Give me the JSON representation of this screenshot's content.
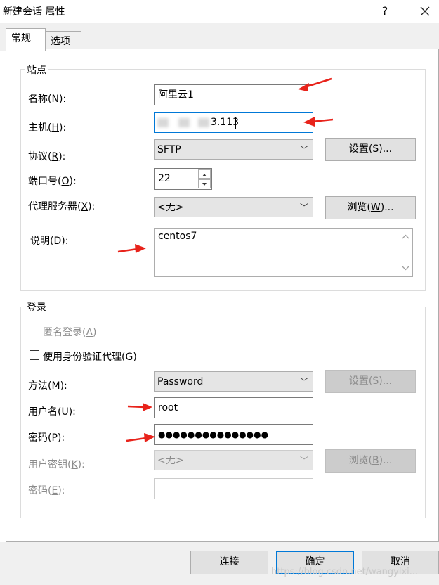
{
  "window": {
    "title": "新建会话 属性",
    "help_label": "?",
    "close_icon": "close-icon"
  },
  "tabs": [
    {
      "label": "常规",
      "active": true
    },
    {
      "label": "选项",
      "active": false
    }
  ],
  "site_group": {
    "title": "站点",
    "name": {
      "label_pre": "名称(",
      "mnemonic": "N",
      "label_post": "):",
      "value": "阿里云1"
    },
    "host": {
      "label_pre": "主机(",
      "mnemonic": "H",
      "label_post": "):",
      "value_visible": "3.113"
    },
    "protocol": {
      "label_pre": "协议(",
      "mnemonic": "R",
      "label_post": "):",
      "value": "SFTP",
      "settings_pre": "设置(",
      "settings_mn": "S",
      "settings_post": ")..."
    },
    "port": {
      "label_pre": "端口号(",
      "mnemonic": "O",
      "label_post": "):",
      "value": "22"
    },
    "proxy": {
      "label_pre": "代理服务器(",
      "mnemonic": "X",
      "label_post": "):",
      "value": "<无>",
      "browse_pre": "浏览(",
      "browse_mn": "W",
      "browse_post": ")..."
    },
    "desc": {
      "label_pre": "说明(",
      "mnemonic": "D",
      "label_post": "):",
      "value": "centos7"
    }
  },
  "login_group": {
    "title": "登录",
    "anonymous": {
      "label_pre": "匿名登录(",
      "mnemonic": "A",
      "label_post": ")",
      "checked": false,
      "enabled": false
    },
    "agent": {
      "label_pre": "使用身份验证代理(",
      "mnemonic": "G",
      "label_post": ")",
      "checked": false,
      "enabled": true
    },
    "method": {
      "label_pre": "方法(",
      "mnemonic": "M",
      "label_post": "):",
      "value": "Password",
      "settings_pre": "设置(",
      "settings_mn": "S",
      "settings_post": ")..."
    },
    "username": {
      "label_pre": "用户名(",
      "mnemonic": "U",
      "label_post": "):",
      "value": "root"
    },
    "password": {
      "label_pre": "密码(",
      "mnemonic": "P",
      "label_post": "):",
      "value": "●●●●●●●●●●●●●●●"
    },
    "user_key": {
      "label_pre": "用户密钥(",
      "mnemonic": "K",
      "label_post": "):",
      "value": "<无>",
      "browse_pre": "浏览(",
      "browse_mn": "B",
      "browse_post": ")..."
    },
    "passphrase": {
      "label_pre": "密码(",
      "mnemonic": "E",
      "label_post": "):",
      "value": ""
    }
  },
  "footer": {
    "connect_label": "连接",
    "ok_label": "确定",
    "cancel_label": "取消",
    "watermark": "https://blog.csdn.net/wangyixi..."
  },
  "colors": {
    "accent": "#0078d7",
    "annotation_arrow": "#e8231b"
  }
}
